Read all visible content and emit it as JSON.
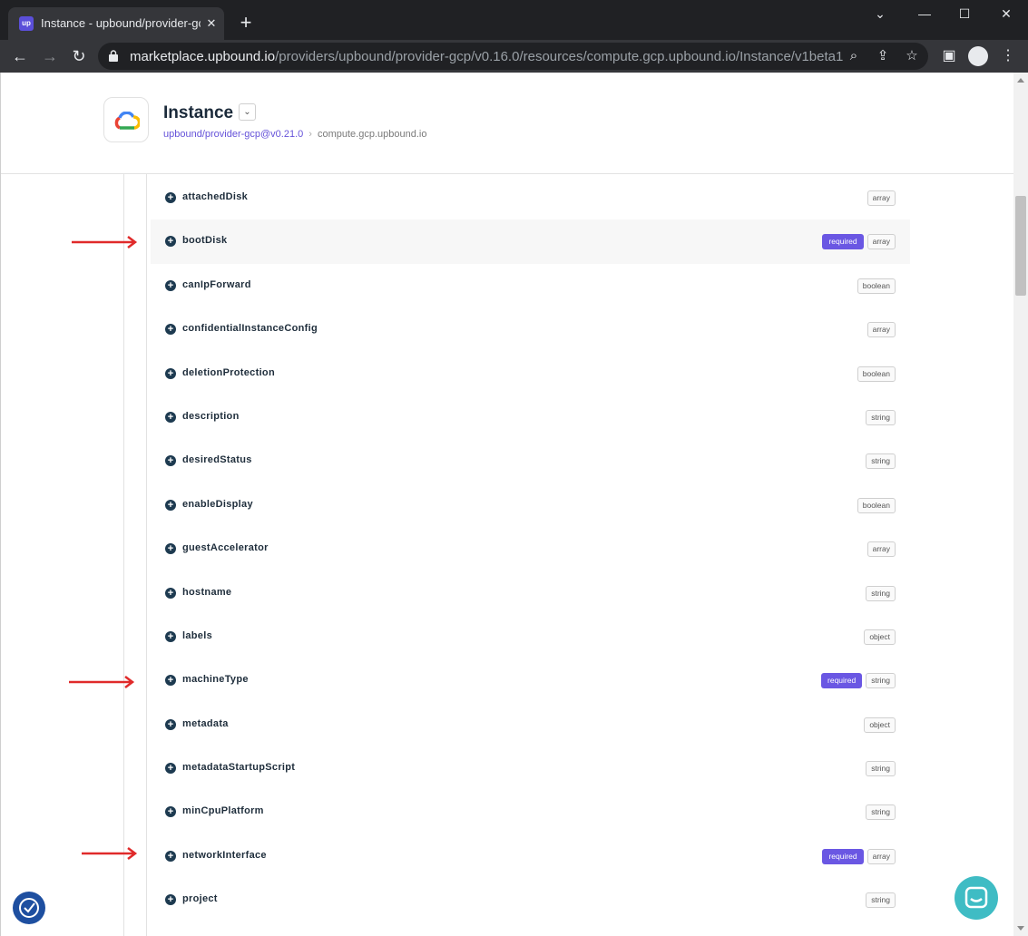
{
  "browser": {
    "tab_title": "Instance - upbound/provider-gcp/Instance",
    "tab_favicon": "up",
    "tab_close": "✕",
    "new_tab": "+",
    "url_host": "marketplace.upbound.io",
    "url_path": "/providers/upbound/provider-gcp/v0.16.0/resources/compute.gcp.upbound.io/Instance/v1beta1"
  },
  "header": {
    "title": "Instance",
    "provider": "upbound/provider-gcp@v0.21.0",
    "group": "compute.gcp.upbound.io"
  },
  "fields": [
    {
      "name": "attachedDisk",
      "type": "array",
      "required": false
    },
    {
      "name": "bootDisk",
      "type": "array",
      "required": true
    },
    {
      "name": "canIpForward",
      "type": "boolean",
      "required": false
    },
    {
      "name": "confidentialInstanceConfig",
      "type": "array",
      "required": false
    },
    {
      "name": "deletionProtection",
      "type": "boolean",
      "required": false
    },
    {
      "name": "description",
      "type": "string",
      "required": false
    },
    {
      "name": "desiredStatus",
      "type": "string",
      "required": false
    },
    {
      "name": "enableDisplay",
      "type": "boolean",
      "required": false
    },
    {
      "name": "guestAccelerator",
      "type": "array",
      "required": false
    },
    {
      "name": "hostname",
      "type": "string",
      "required": false
    },
    {
      "name": "labels",
      "type": "object",
      "required": false
    },
    {
      "name": "machineType",
      "type": "string",
      "required": true
    },
    {
      "name": "metadata",
      "type": "object",
      "required": false
    },
    {
      "name": "metadataStartupScript",
      "type": "string",
      "required": false
    },
    {
      "name": "minCpuPlatform",
      "type": "string",
      "required": false
    },
    {
      "name": "networkInterface",
      "type": "array",
      "required": true
    },
    {
      "name": "project",
      "type": "string",
      "required": false
    }
  ],
  "required_label": "required",
  "colors": {
    "accent": "#6a57e3",
    "arrow": "#e02a2a",
    "chat": "#3fbcc4",
    "a11y": "#1e4fa0"
  }
}
